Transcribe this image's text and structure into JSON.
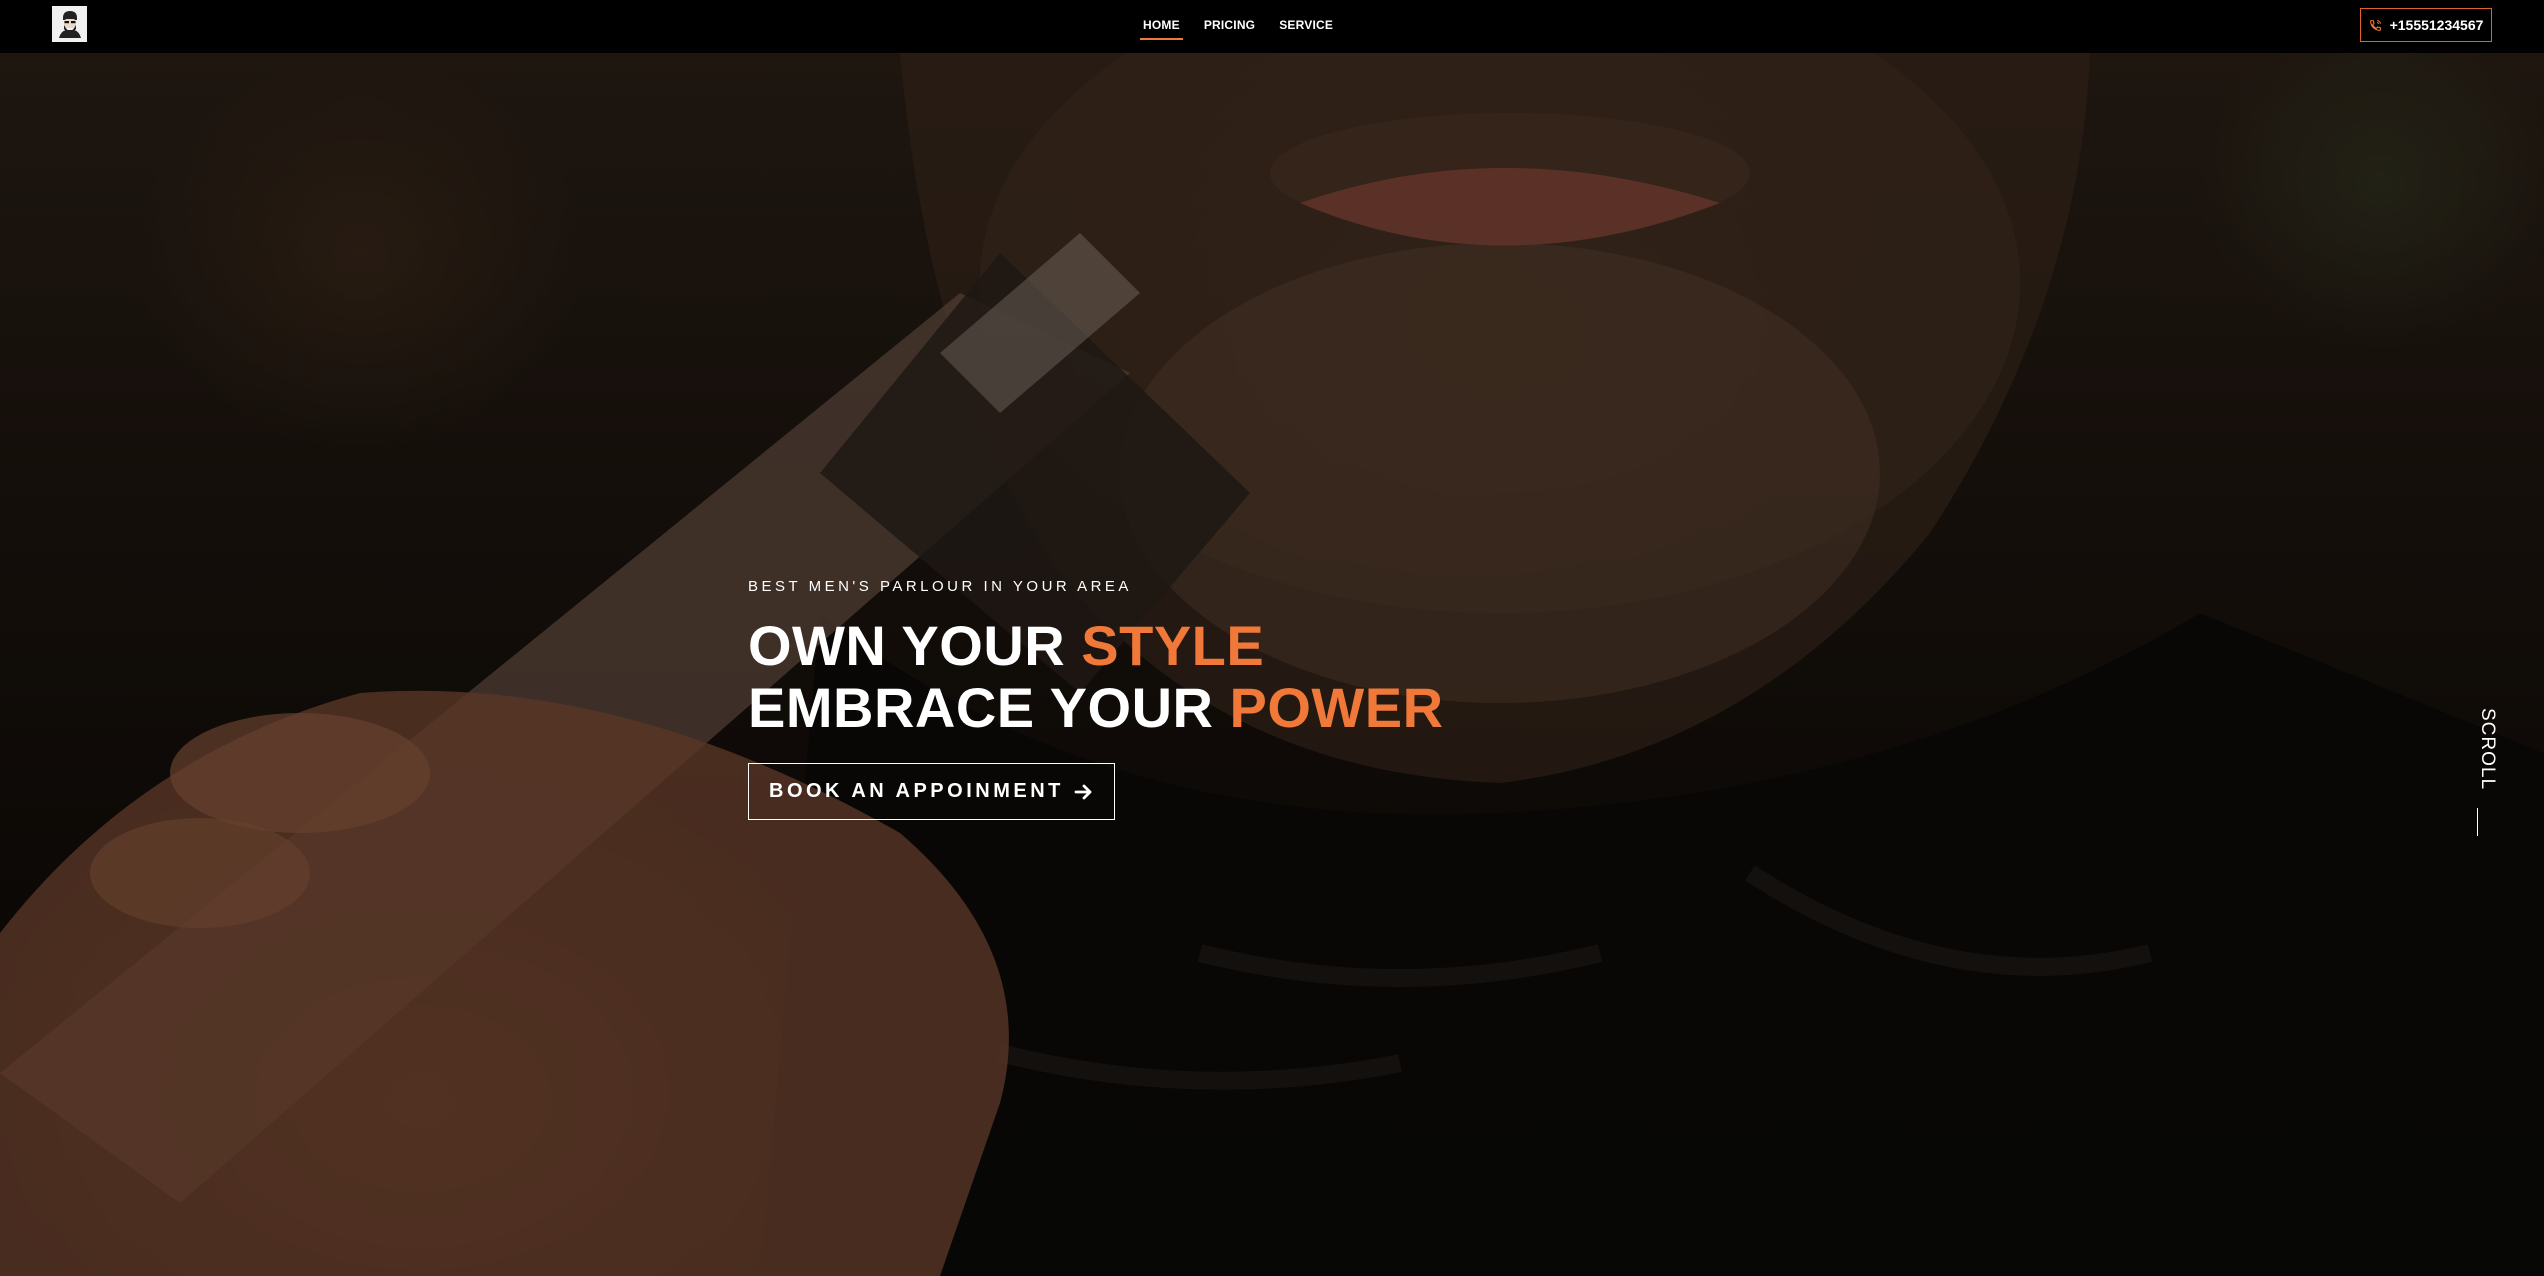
{
  "header": {
    "logo_icon": "bearded-man-logo-icon",
    "nav": [
      {
        "label": "HOME",
        "active": true
      },
      {
        "label": "PRICING",
        "active": false
      },
      {
        "label": "SERVICE",
        "active": false
      }
    ],
    "phone": {
      "icon": "phone-icon",
      "label": "+15551234567"
    }
  },
  "hero": {
    "eyebrow": "BEST MEN'S PARLOUR IN YOUR AREA",
    "line1": {
      "plain": "OWN YOUR ",
      "accent": "STYLE"
    },
    "line2": {
      "plain": "EMBRACE YOUR ",
      "accent": "POWER"
    },
    "cta": {
      "label": "BOOK AN APPOINMENT",
      "icon": "arrow-right-icon"
    },
    "scroll_label": "SCROLL"
  },
  "colors": {
    "accent": "#f0793a",
    "phone_border": "#e0622c",
    "background": "#000000",
    "text": "#ffffff"
  }
}
